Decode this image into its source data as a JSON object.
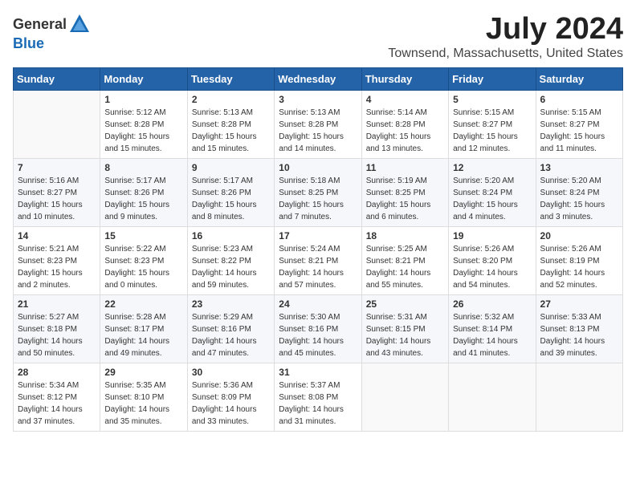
{
  "header": {
    "logo_general": "General",
    "logo_blue": "Blue",
    "month_title": "July 2024",
    "location": "Townsend, Massachusetts, United States"
  },
  "days_of_week": [
    "Sunday",
    "Monday",
    "Tuesday",
    "Wednesday",
    "Thursday",
    "Friday",
    "Saturday"
  ],
  "weeks": [
    [
      {
        "day": "",
        "info": ""
      },
      {
        "day": "1",
        "info": "Sunrise: 5:12 AM\nSunset: 8:28 PM\nDaylight: 15 hours\nand 15 minutes."
      },
      {
        "day": "2",
        "info": "Sunrise: 5:13 AM\nSunset: 8:28 PM\nDaylight: 15 hours\nand 15 minutes."
      },
      {
        "day": "3",
        "info": "Sunrise: 5:13 AM\nSunset: 8:28 PM\nDaylight: 15 hours\nand 14 minutes."
      },
      {
        "day": "4",
        "info": "Sunrise: 5:14 AM\nSunset: 8:28 PM\nDaylight: 15 hours\nand 13 minutes."
      },
      {
        "day": "5",
        "info": "Sunrise: 5:15 AM\nSunset: 8:27 PM\nDaylight: 15 hours\nand 12 minutes."
      },
      {
        "day": "6",
        "info": "Sunrise: 5:15 AM\nSunset: 8:27 PM\nDaylight: 15 hours\nand 11 minutes."
      }
    ],
    [
      {
        "day": "7",
        "info": "Sunrise: 5:16 AM\nSunset: 8:27 PM\nDaylight: 15 hours\nand 10 minutes."
      },
      {
        "day": "8",
        "info": "Sunrise: 5:17 AM\nSunset: 8:26 PM\nDaylight: 15 hours\nand 9 minutes."
      },
      {
        "day": "9",
        "info": "Sunrise: 5:17 AM\nSunset: 8:26 PM\nDaylight: 15 hours\nand 8 minutes."
      },
      {
        "day": "10",
        "info": "Sunrise: 5:18 AM\nSunset: 8:25 PM\nDaylight: 15 hours\nand 7 minutes."
      },
      {
        "day": "11",
        "info": "Sunrise: 5:19 AM\nSunset: 8:25 PM\nDaylight: 15 hours\nand 6 minutes."
      },
      {
        "day": "12",
        "info": "Sunrise: 5:20 AM\nSunset: 8:24 PM\nDaylight: 15 hours\nand 4 minutes."
      },
      {
        "day": "13",
        "info": "Sunrise: 5:20 AM\nSunset: 8:24 PM\nDaylight: 15 hours\nand 3 minutes."
      }
    ],
    [
      {
        "day": "14",
        "info": "Sunrise: 5:21 AM\nSunset: 8:23 PM\nDaylight: 15 hours\nand 2 minutes."
      },
      {
        "day": "15",
        "info": "Sunrise: 5:22 AM\nSunset: 8:23 PM\nDaylight: 15 hours\nand 0 minutes."
      },
      {
        "day": "16",
        "info": "Sunrise: 5:23 AM\nSunset: 8:22 PM\nDaylight: 14 hours\nand 59 minutes."
      },
      {
        "day": "17",
        "info": "Sunrise: 5:24 AM\nSunset: 8:21 PM\nDaylight: 14 hours\nand 57 minutes."
      },
      {
        "day": "18",
        "info": "Sunrise: 5:25 AM\nSunset: 8:21 PM\nDaylight: 14 hours\nand 55 minutes."
      },
      {
        "day": "19",
        "info": "Sunrise: 5:26 AM\nSunset: 8:20 PM\nDaylight: 14 hours\nand 54 minutes."
      },
      {
        "day": "20",
        "info": "Sunrise: 5:26 AM\nSunset: 8:19 PM\nDaylight: 14 hours\nand 52 minutes."
      }
    ],
    [
      {
        "day": "21",
        "info": "Sunrise: 5:27 AM\nSunset: 8:18 PM\nDaylight: 14 hours\nand 50 minutes."
      },
      {
        "day": "22",
        "info": "Sunrise: 5:28 AM\nSunset: 8:17 PM\nDaylight: 14 hours\nand 49 minutes."
      },
      {
        "day": "23",
        "info": "Sunrise: 5:29 AM\nSunset: 8:16 PM\nDaylight: 14 hours\nand 47 minutes."
      },
      {
        "day": "24",
        "info": "Sunrise: 5:30 AM\nSunset: 8:16 PM\nDaylight: 14 hours\nand 45 minutes."
      },
      {
        "day": "25",
        "info": "Sunrise: 5:31 AM\nSunset: 8:15 PM\nDaylight: 14 hours\nand 43 minutes."
      },
      {
        "day": "26",
        "info": "Sunrise: 5:32 AM\nSunset: 8:14 PM\nDaylight: 14 hours\nand 41 minutes."
      },
      {
        "day": "27",
        "info": "Sunrise: 5:33 AM\nSunset: 8:13 PM\nDaylight: 14 hours\nand 39 minutes."
      }
    ],
    [
      {
        "day": "28",
        "info": "Sunrise: 5:34 AM\nSunset: 8:12 PM\nDaylight: 14 hours\nand 37 minutes."
      },
      {
        "day": "29",
        "info": "Sunrise: 5:35 AM\nSunset: 8:10 PM\nDaylight: 14 hours\nand 35 minutes."
      },
      {
        "day": "30",
        "info": "Sunrise: 5:36 AM\nSunset: 8:09 PM\nDaylight: 14 hours\nand 33 minutes."
      },
      {
        "day": "31",
        "info": "Sunrise: 5:37 AM\nSunset: 8:08 PM\nDaylight: 14 hours\nand 31 minutes."
      },
      {
        "day": "",
        "info": ""
      },
      {
        "day": "",
        "info": ""
      },
      {
        "day": "",
        "info": ""
      }
    ]
  ]
}
